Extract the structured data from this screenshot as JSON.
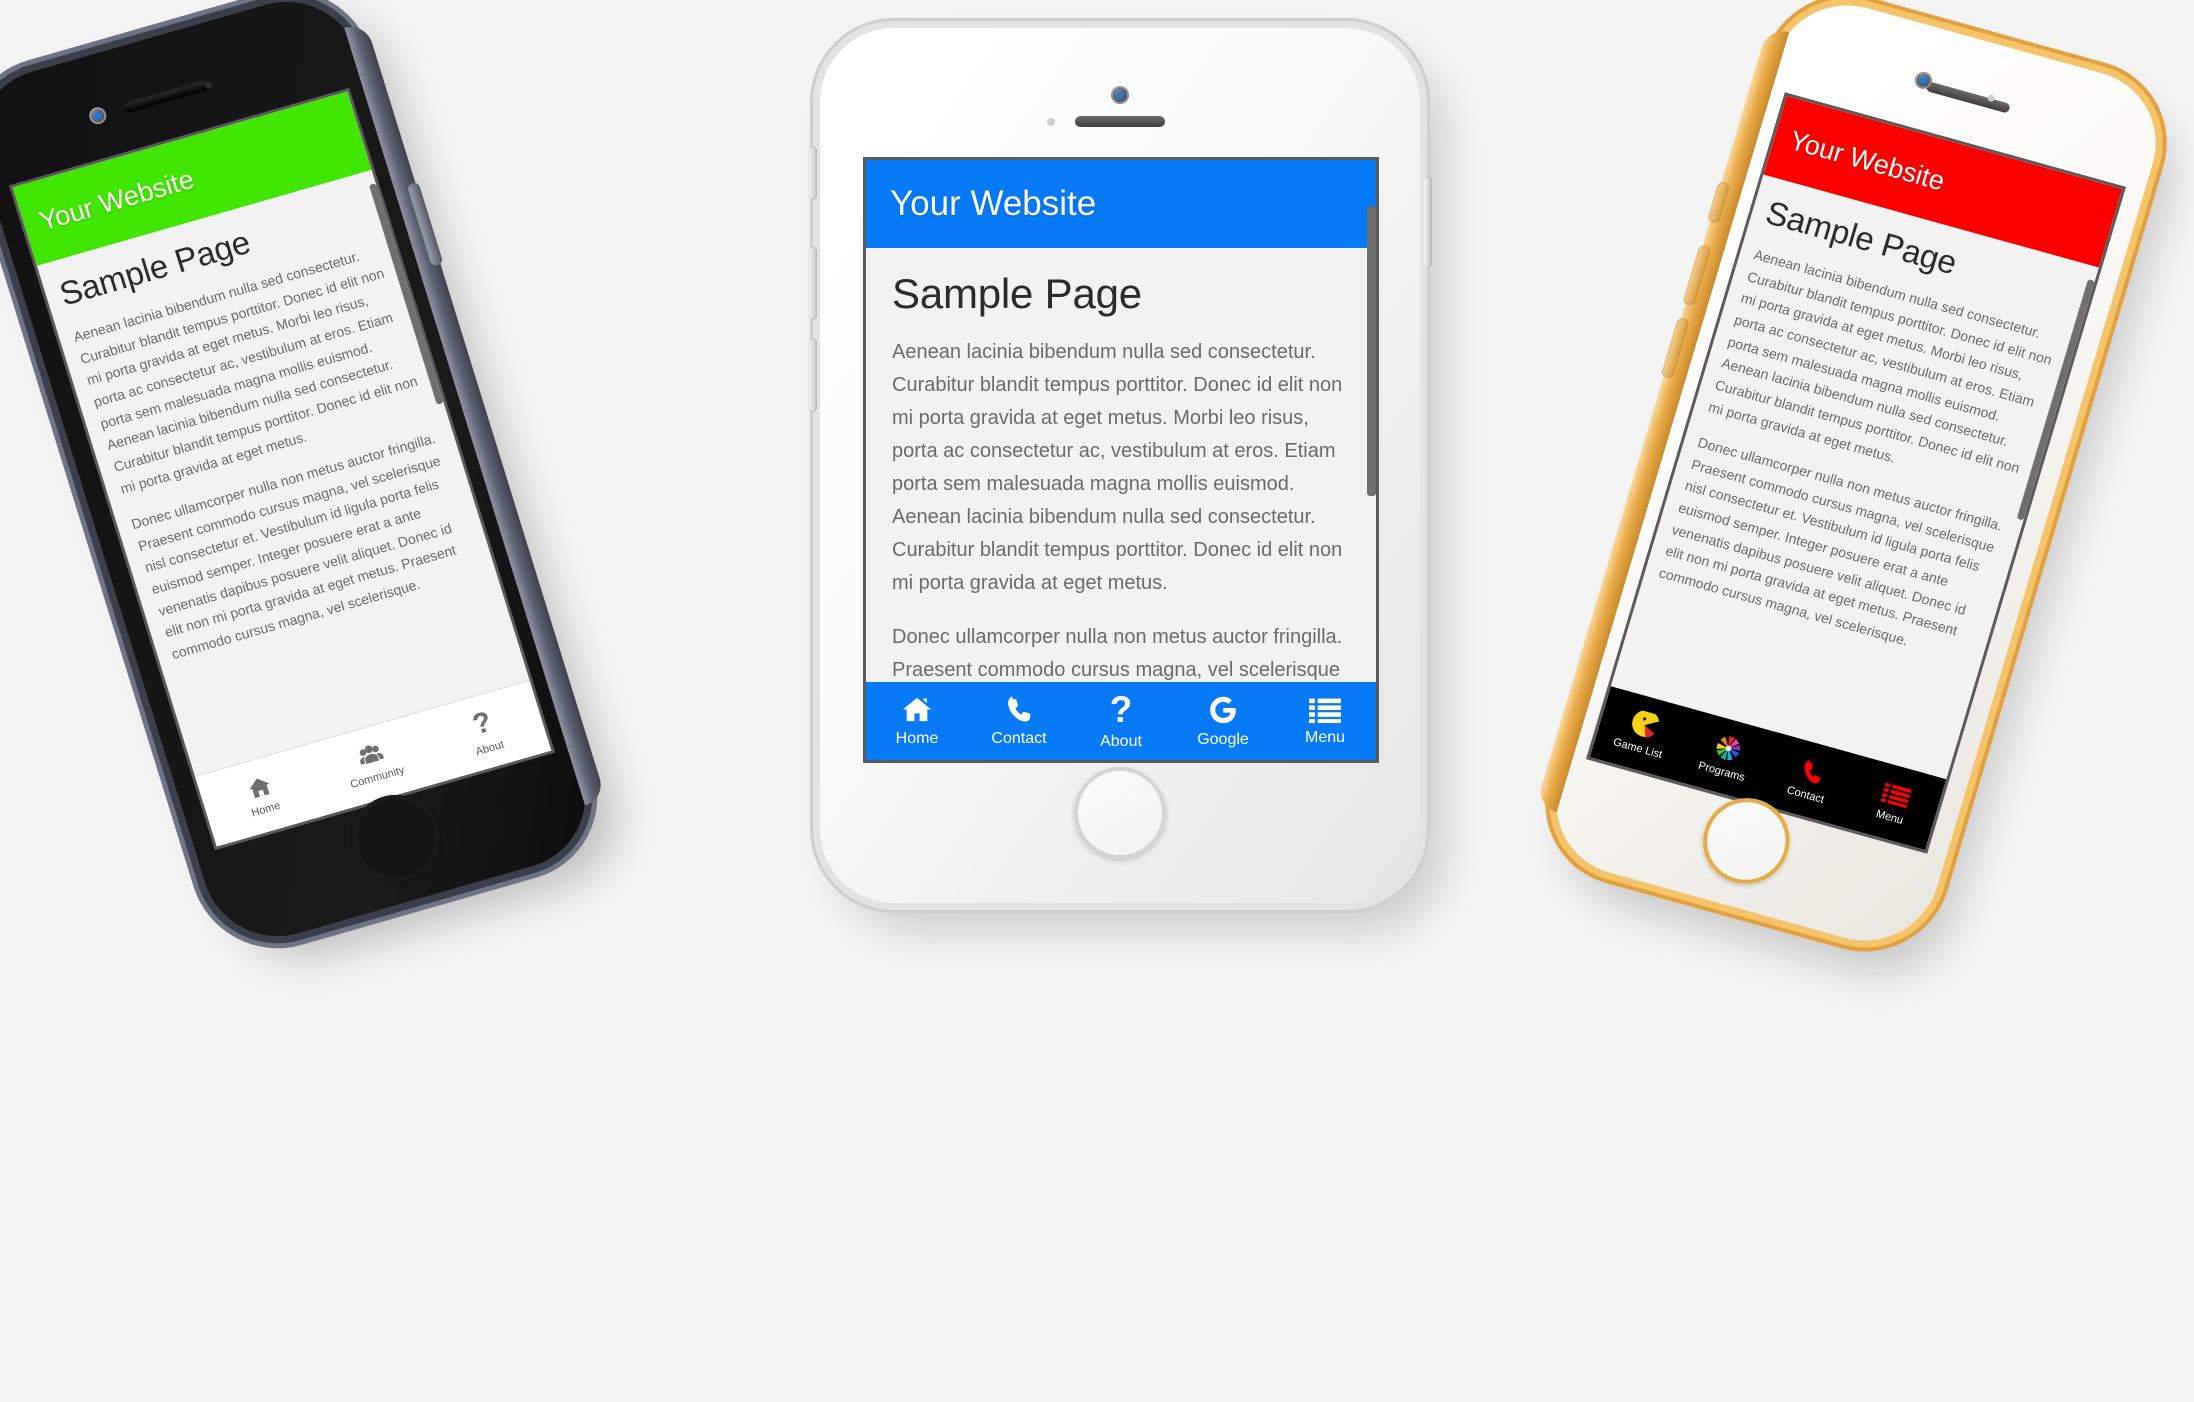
{
  "background_color": "#f3f3f3",
  "website": {
    "title": "Your Website",
    "heading": "Sample Page",
    "paragraph_1": "Aenean lacinia bibendum nulla sed consectetur. Curabitur blandit tempus porttitor. Donec id elit non mi porta gravida at eget metus. Morbi leo risus, porta ac consectetur ac, vestibulum at eros. Etiam porta sem malesuada magna mollis euismod. Aenean lacinia bibendum nulla sed consectetur. Curabitur blandit tempus porttitor. Donec id elit non mi porta gravida at eget metus.",
    "paragraph_2": "Donec ullamcorper nulla non metus auctor fringilla. Praesent commodo cursus magna, vel scelerisque nisl consectetur et. Vestibulum id ligula porta felis euismod semper. Integer posuere erat a ante venenatis dapibus posuere velit aliquet. Donec id elit non mi porta gravida at eget metus. Praesent commodo cursus magna, vel scelerisque."
  },
  "phones": [
    {
      "id": "phone-left",
      "device": "iPhone Space Gray",
      "frame_color": "#5d6372",
      "header_color": "#41e600",
      "nav_background": "#ffffff",
      "nav_icon_color": "#6f6f6f",
      "nav": [
        {
          "icon": "home-icon",
          "label": "Home"
        },
        {
          "icon": "community-icon",
          "label": "Community"
        },
        {
          "icon": "question-mark-icon",
          "label": "About"
        }
      ]
    },
    {
      "id": "phone-center",
      "device": "iPhone White",
      "frame_color": "#e3e3e3",
      "header_color": "#077bf7",
      "nav_background": "#077bf7",
      "nav_icon_color": "#ffffff",
      "nav": [
        {
          "icon": "home-icon",
          "label": "Home"
        },
        {
          "icon": "phone-icon",
          "label": "Contact"
        },
        {
          "icon": "question-mark-icon",
          "label": "About"
        },
        {
          "icon": "google-g-icon",
          "label": "Google"
        },
        {
          "icon": "list-menu-icon",
          "label": "Menu"
        }
      ]
    },
    {
      "id": "phone-right",
      "device": "iPhone Gold",
      "frame_color": "#e2a03f",
      "header_color": "#fc0000",
      "nav_background": "#000000",
      "nav_icon_color": "#ff0000",
      "nav": [
        {
          "icon": "pacman-icon",
          "label": "Game List"
        },
        {
          "icon": "pinwheel-icon",
          "label": "Programs"
        },
        {
          "icon": "phone-icon",
          "label": "Contact"
        },
        {
          "icon": "list-menu-icon",
          "label": "Menu"
        }
      ]
    }
  ]
}
